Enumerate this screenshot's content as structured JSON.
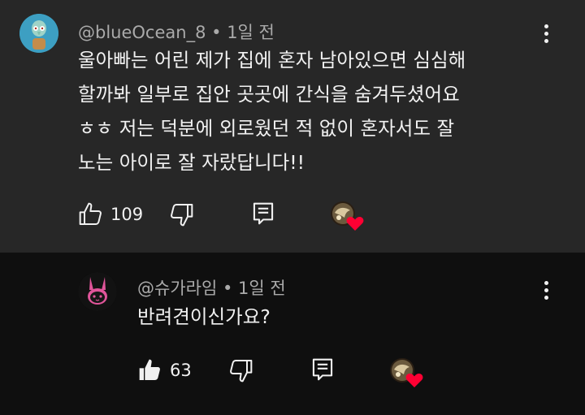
{
  "comment": {
    "author": "@blueOcean_8",
    "time": "1일 전",
    "lines": [
      "울아빠는 어린 제가 집에 혼자 남아있으면 심심해",
      "할까봐 일부로 집안 곳곳에 간식을 숨겨두셨어요",
      "ㅎㅎ 저는 덕분에 외로웠던 적 없이 혼자서도 잘",
      "노는 아이로 잘 자랐답니다!!"
    ],
    "like_count": "109",
    "colors": {
      "background": "#272727",
      "heart": "#ff0033"
    }
  },
  "reply": {
    "author": "@슈가라임",
    "time": "1일 전",
    "text": "반려견이신가요?",
    "like_count": "63",
    "colors": {
      "background": "#0f0f0f",
      "avatar_accent": "#e0559a"
    }
  }
}
